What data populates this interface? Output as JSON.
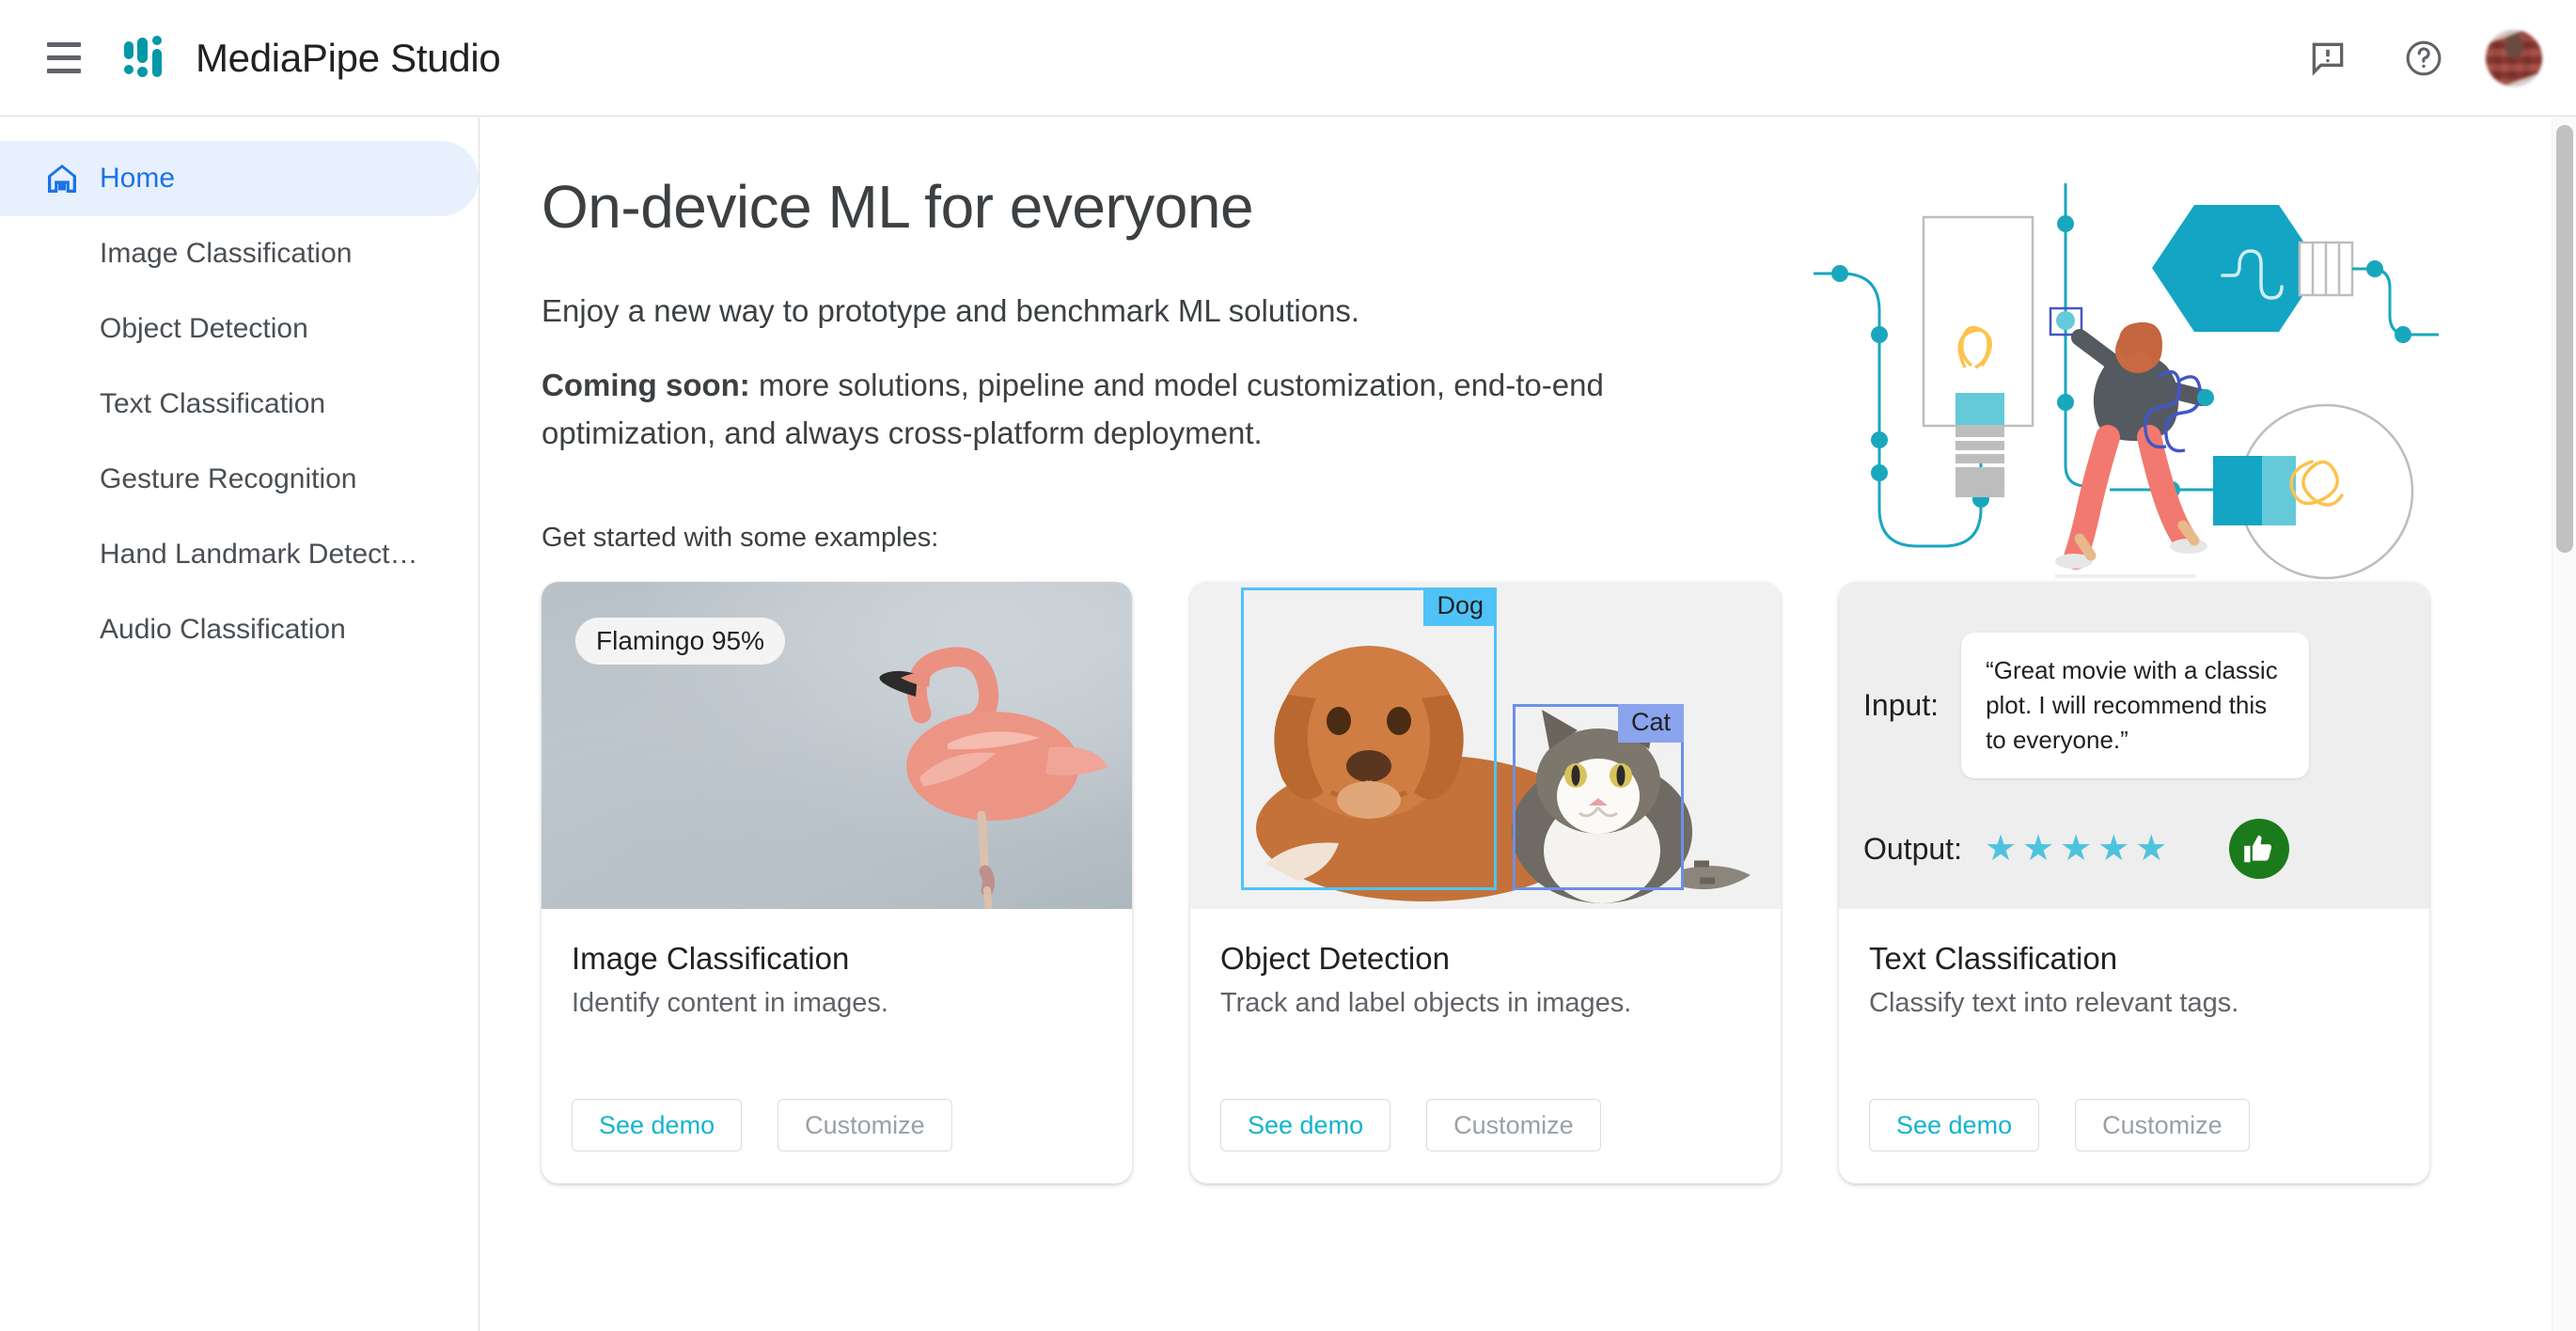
{
  "header": {
    "menu_icon": "hamburger-menu-icon",
    "logo_icon": "mediapipe-logo-icon",
    "title": "MediaPipe Studio",
    "feedback_icon": "feedback-icon",
    "help_icon": "help-icon",
    "avatar_icon": "user-avatar"
  },
  "sidebar": {
    "items": [
      {
        "label": "Home",
        "icon": "home-icon",
        "active": true
      },
      {
        "label": "Image Classification",
        "active": false
      },
      {
        "label": "Object Detection",
        "active": false
      },
      {
        "label": "Text Classification",
        "active": false
      },
      {
        "label": "Gesture Recognition",
        "active": false
      },
      {
        "label": "Hand Landmark Detect…",
        "active": false
      },
      {
        "label": "Audio Classification",
        "active": false
      }
    ]
  },
  "hero": {
    "title": "On-device ML for everyone",
    "subtitle": "Enjoy a new way to prototype and benchmark ML solutions.",
    "coming_soon_label": "Coming soon:",
    "coming_soon_text": " more solutions, pipeline and model customization, end-to-end optimization, and always cross-platform deployment.",
    "illustration": "ml-pipeline-illustration"
  },
  "examples": {
    "label": "Get started with some examples:",
    "cards": [
      {
        "title": "Image Classification",
        "description": "Identify content in images.",
        "media_kind": "flamingo-photo",
        "chip": "Flamingo 95%",
        "primary_button": "See demo",
        "secondary_button": "Customize"
      },
      {
        "title": "Object Detection",
        "description": "Track and label objects in images.",
        "media_kind": "dog-cat-photo",
        "box_labels": [
          "Dog",
          "Cat"
        ],
        "primary_button": "See demo",
        "secondary_button": "Customize"
      },
      {
        "title": "Text Classification",
        "description": "Classify text into relevant tags.",
        "media_kind": "sentiment-diagram",
        "input_label": "Input:",
        "input_text": "“Great movie with a classic plot. I will recommend this to everyone.”",
        "output_label": "Output:",
        "star_count": 5,
        "sentiment_icon": "thumbs-up-icon",
        "primary_button": "See demo",
        "secondary_button": "Customize"
      }
    ]
  },
  "colors": {
    "brand_teal": "#0097a7",
    "accent_blue": "#1a73e8",
    "active_nav_bg": "#e8f0fe",
    "demo_link": "#12b5cb",
    "muted_text": "#9aa0a6",
    "dog_box": "#4fc3f7",
    "cat_box": "#6c8fe8",
    "star": "#4ec3dd",
    "thumb_green": "#1b7a1b"
  },
  "scrollbar": {
    "name": "vertical-scrollbar"
  }
}
